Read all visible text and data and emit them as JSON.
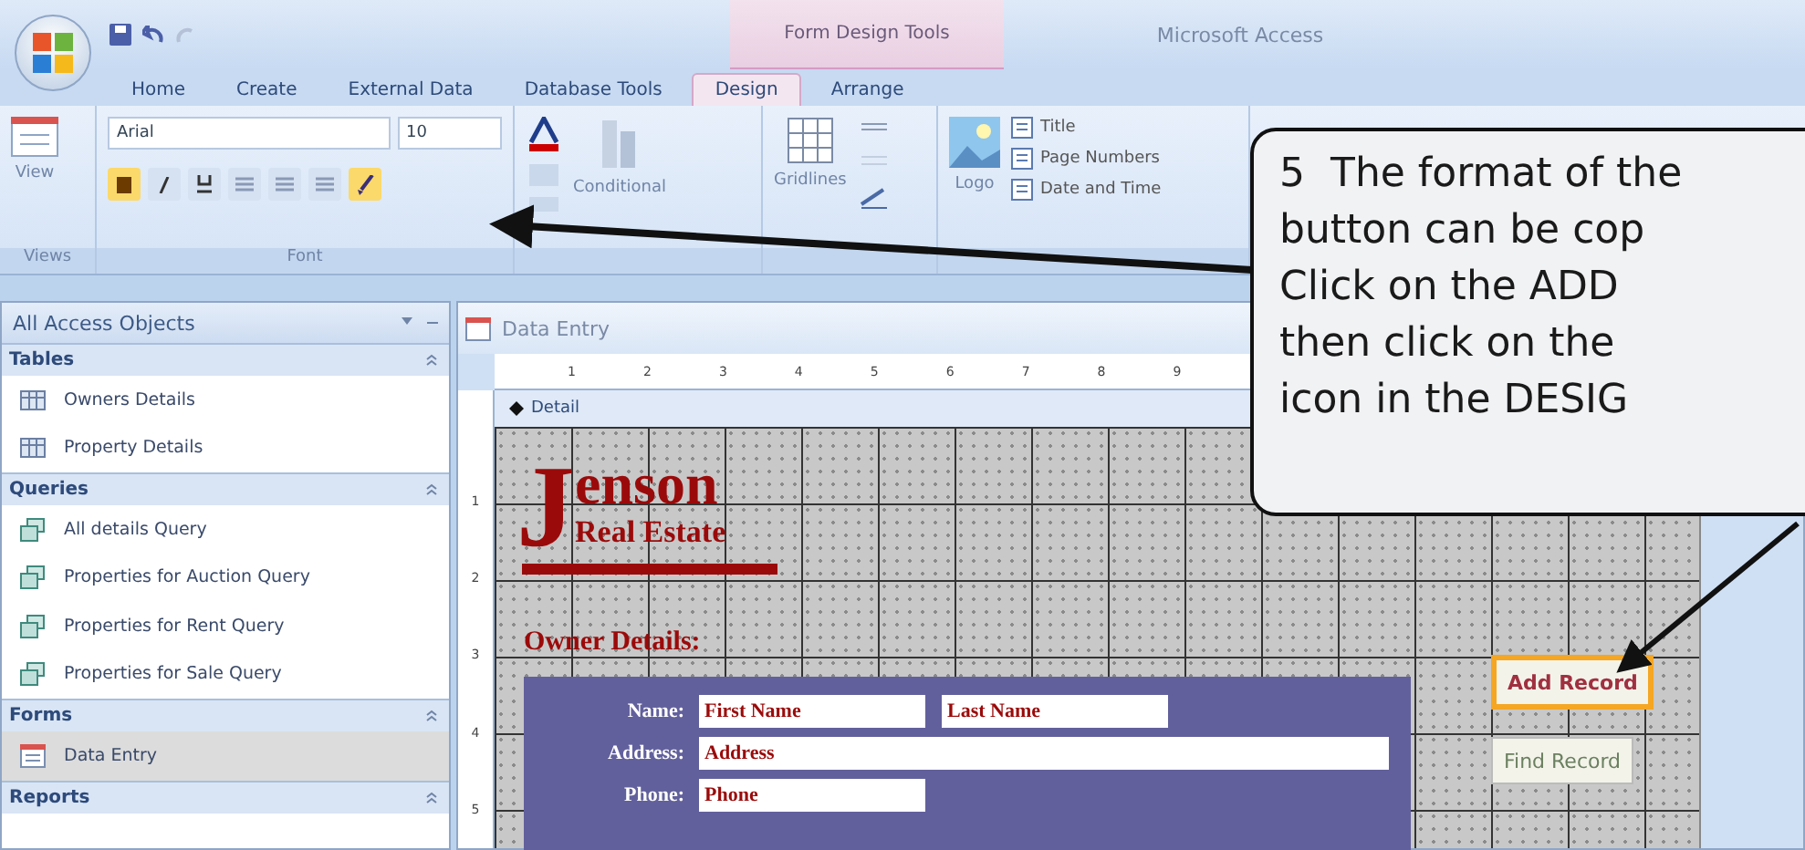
{
  "title_bar": {
    "context_group": "Form Design Tools",
    "app_title": "Microsoft Access"
  },
  "ribbon_tabs": [
    {
      "label": "Home",
      "selected": false
    },
    {
      "label": "Create",
      "selected": false
    },
    {
      "label": "External Data",
      "selected": false
    },
    {
      "label": "Database Tools",
      "selected": false
    },
    {
      "label": "Design",
      "selected": true
    },
    {
      "label": "Arrange",
      "selected": false
    }
  ],
  "ribbon": {
    "views": {
      "button": "View",
      "group": "Views"
    },
    "font": {
      "font_name": "Arial",
      "font_size": "10",
      "group": "Font",
      "buttons": [
        {
          "kind": "bold",
          "selected": true
        },
        {
          "kind": "italic",
          "selected": false
        },
        {
          "kind": "underline",
          "selected": false
        },
        {
          "kind": "align-left",
          "selected": false
        },
        {
          "kind": "align-center",
          "selected": false
        },
        {
          "kind": "align-right",
          "selected": false
        },
        {
          "kind": "format-painter",
          "selected": true
        }
      ]
    },
    "conditional": "Conditional",
    "gridlines": "Gridlines",
    "logo": "Logo",
    "header_controls": [
      "Title",
      "Page Numbers",
      "Date and Time"
    ]
  },
  "nav_pane": {
    "title": "All Access Objects",
    "groups": [
      {
        "label": "Tables",
        "items": [
          {
            "label": "Owners Details",
            "kind": "table",
            "selected": false
          },
          {
            "label": "Property Details",
            "kind": "table",
            "selected": false
          }
        ]
      },
      {
        "label": "Queries",
        "items": [
          {
            "label": "All details Query",
            "kind": "query",
            "selected": false
          },
          {
            "label": "Properties for Auction Query",
            "kind": "query",
            "selected": false
          },
          {
            "label": "Properties for Rent Query",
            "kind": "query",
            "selected": false
          },
          {
            "label": "Properties for Sale Query",
            "kind": "query",
            "selected": false
          }
        ]
      },
      {
        "label": "Forms",
        "items": [
          {
            "label": "Data Entry",
            "kind": "form",
            "selected": true
          }
        ]
      },
      {
        "label": "Reports"
      }
    ]
  },
  "document": {
    "tab_title": "Data Entry",
    "ruler_numbers": [
      "1",
      "2",
      "3",
      "4",
      "5",
      "6",
      "7",
      "8",
      "9"
    ],
    "vertical_ruler_numbers": [
      "1",
      "2",
      "3",
      "4",
      "5"
    ],
    "section": "Detail",
    "form": {
      "logo_initial": "J",
      "logo_name": "enson",
      "logo_subtitle": "Real Estate",
      "section_label": "Owner Details:",
      "fields": [
        {
          "label": "Name:",
          "boxes": [
            "First Name",
            "Last Name"
          ]
        },
        {
          "label": "Address:",
          "boxes": [
            "Address"
          ]
        },
        {
          "label": "Phone:",
          "boxes": [
            "Phone"
          ]
        }
      ],
      "buttons": [
        {
          "label": "Add Record",
          "selected": true
        },
        {
          "label": "Find Record",
          "selected": false
        }
      ]
    }
  },
  "callout": {
    "step": "5",
    "lines": [
      "The format of the",
      "button can be cop",
      "Click on the ADD",
      "then click on the",
      "icon in the DESIG"
    ]
  }
}
